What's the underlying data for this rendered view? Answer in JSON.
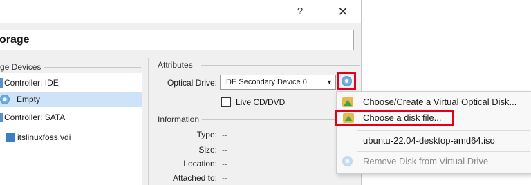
{
  "titlebar": {
    "help": "?",
    "close": "✕"
  },
  "section": {
    "title": "orage"
  },
  "storage_devices": {
    "label": "ge Devices",
    "tree": [
      {
        "label": "Controller: IDE",
        "kind": "controller"
      },
      {
        "label": "Empty",
        "kind": "optical",
        "selected": true
      },
      {
        "label": "Controller: SATA",
        "kind": "controller"
      },
      {
        "label": "itslinuxfoss.vdi",
        "kind": "disk"
      }
    ]
  },
  "attributes": {
    "label": "Attributes",
    "optical_drive_label": "Optical Drive:",
    "optical_drive_value": "IDE Secondary Device 0",
    "live_cd_label": "Live CD/DVD"
  },
  "information": {
    "label": "Information",
    "rows": [
      {
        "label": "Type:",
        "value": "--"
      },
      {
        "label": "Size:",
        "value": "--"
      },
      {
        "label": "Location:",
        "value": "--"
      },
      {
        "label": "Attached to:",
        "value": "--"
      }
    ]
  },
  "menu": {
    "items": [
      {
        "label": "Choose/Create a Virtual Optical Disk...",
        "icon": "folder-icon"
      },
      {
        "label": "Choose a disk file...",
        "icon": "folder-icon"
      },
      {
        "label": "ubuntu-22.04-desktop-amd64.iso",
        "icon": ""
      },
      {
        "label": "Remove Disk from Virtual Drive",
        "icon": "disc-icon",
        "disabled": true
      }
    ]
  },
  "colors": {
    "highlight_red": "#e0001a",
    "selection": "#cfe3f8",
    "disc_blue": "#3d86c6"
  }
}
